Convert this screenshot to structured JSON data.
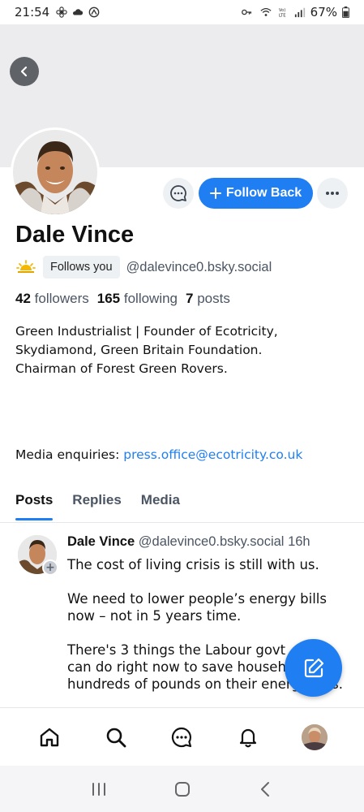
{
  "status_bar": {
    "time": "21:54",
    "battery": "67%"
  },
  "profile": {
    "name": "Dale Vince",
    "follows_you": "Follows you",
    "handle": "@dalevince0.bsky.social",
    "followers_count": "42",
    "followers_label": "followers",
    "following_count": "165",
    "following_label": "following",
    "posts_count": "7",
    "posts_label": "posts",
    "follow_button": "Follow Back",
    "bio_lines": [
      "Green Industrialist | Founder of Ecotricity,",
      "Skydiamond, Green Britain Foundation.",
      "Chairman of Forest Green Rovers."
    ],
    "enquiry_label": "Media enquiries:",
    "enquiry_email": "press.office@ecotricity.co.uk"
  },
  "tabs": [
    {
      "label": "Posts",
      "active": true
    },
    {
      "label": "Replies",
      "active": false
    },
    {
      "label": "Media",
      "active": false
    }
  ],
  "post": {
    "author": "Dale Vince",
    "handle": "@dalevince0.bsky.social",
    "time": "16h",
    "paragraphs": [
      [
        "The cost of living crisis is still with us."
      ],
      [
        "We need to lower people’s energy bills",
        "now – not in 5 years time."
      ],
      [
        "There's 3 things the Labour govt",
        "can do right now to save househ",
        "hundreds of pounds on their energy bills."
      ]
    ]
  },
  "bottom_nav": [
    "home-icon",
    "search-icon",
    "chat-icon",
    "bell-icon",
    "profile-avatar"
  ],
  "colors": {
    "accent": "#1f7ef2",
    "banner": "#ececee",
    "muted_text": "#4b5563"
  }
}
